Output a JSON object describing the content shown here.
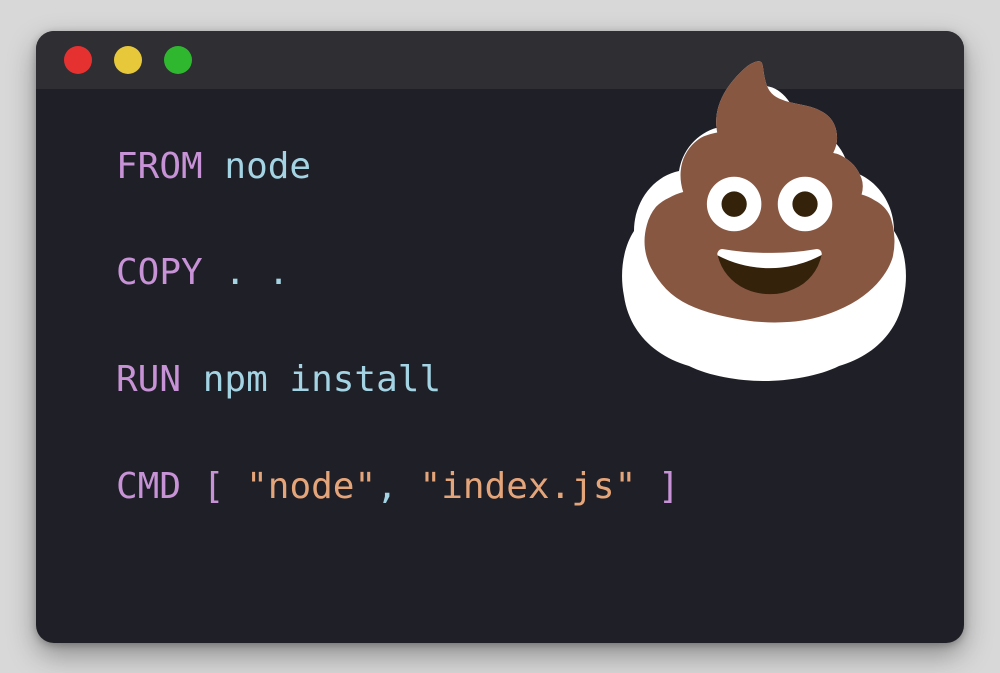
{
  "code": {
    "line1": {
      "keyword": "FROM",
      "arg": "node"
    },
    "line2": {
      "keyword": "COPY",
      "arg": ". ."
    },
    "line3": {
      "keyword": "RUN",
      "arg": "npm install"
    },
    "line4": {
      "keyword": "CMD",
      "bracket_open": "[",
      "str1": "\"node\"",
      "comma": ",",
      "str2": "\"index.js\"",
      "bracket_close": "]"
    }
  },
  "emoji": "💩"
}
